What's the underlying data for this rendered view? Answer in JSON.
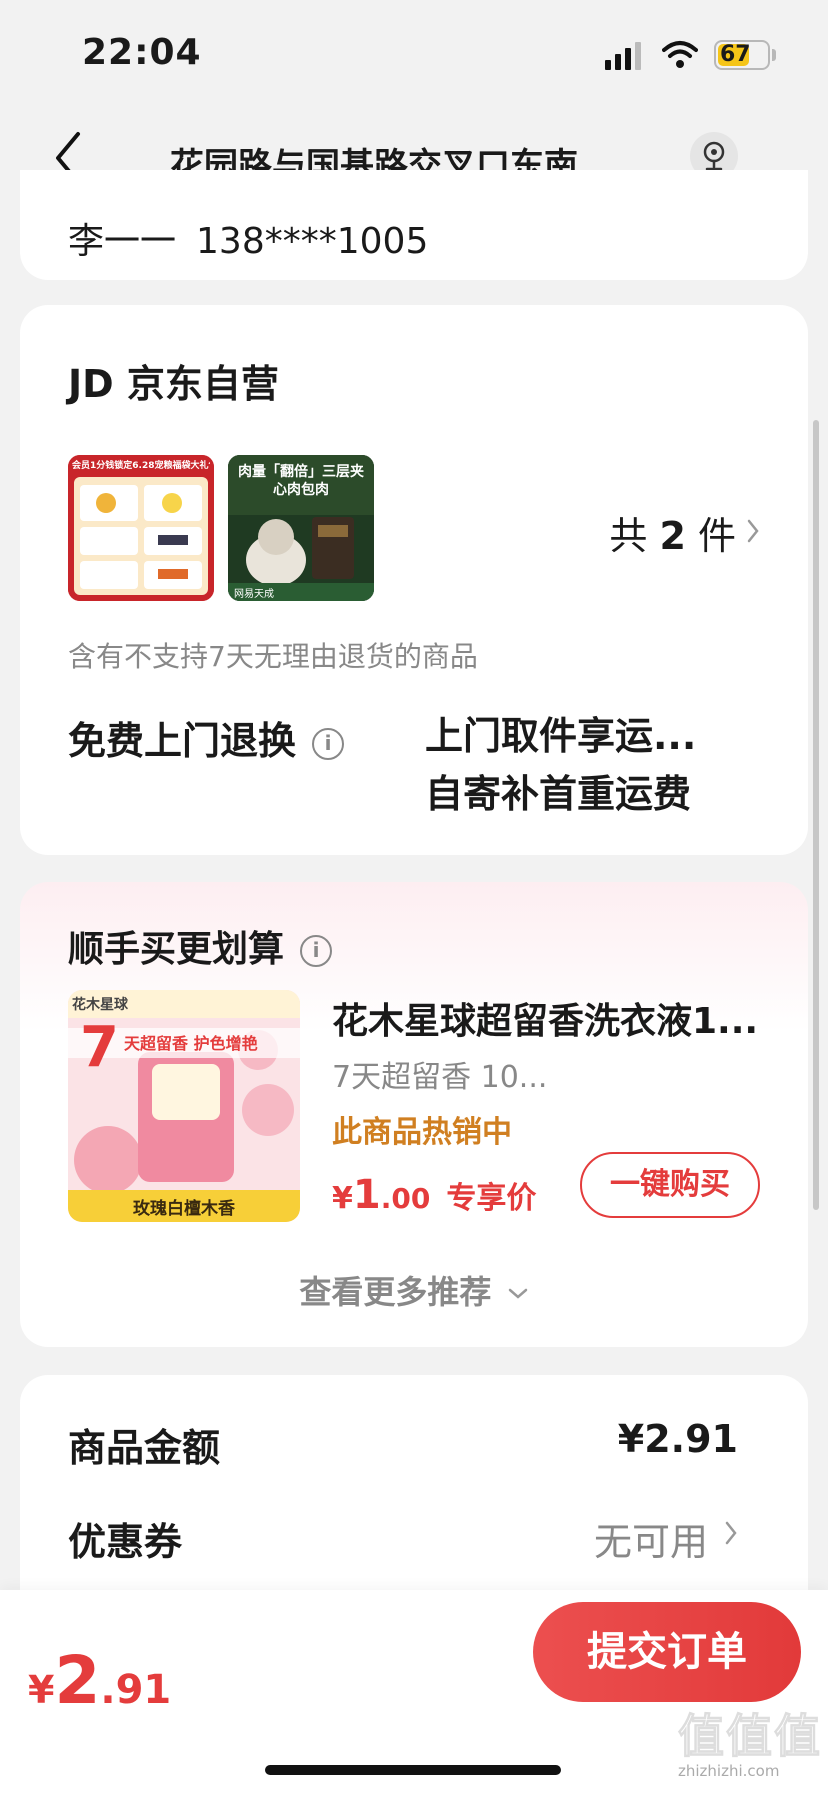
{
  "status_bar": {
    "time": "22:04",
    "battery": "67",
    "battery_level_percent": 67
  },
  "nav": {
    "title": "花园路与国基路交叉口东南..."
  },
  "address": {
    "name": "李一一",
    "phone": "138****1005"
  },
  "order": {
    "shop_name": "JD 京东自营",
    "item_count_prefix": "共",
    "item_count": "2",
    "item_count_suffix": "件",
    "thumb1_text": "会员1分钱锁定6.28宠粮福袋大礼包",
    "thumb2_text": "肉量「翻倍」三层夹心肉包肉",
    "thumb2_brand": "网易天成",
    "return_notice": "含有不支持7天无理由退货的商品",
    "return_label": "免费上门退换",
    "return_line1": "上门取件享运...",
    "return_line2": "自寄补首重运费"
  },
  "recommend": {
    "title": "顺手买更划算",
    "product_name": "花木星球超留香洗衣液1...",
    "product_sub": "7天超留香 10...",
    "hot_text": "此商品热销中",
    "price_currency": "¥",
    "price_int": "1",
    "price_dec": ".00",
    "price_tag": "专享价",
    "buy_label": "一键购买",
    "more_label": "查看更多推荐",
    "img_big": "7",
    "img_banner": "天超留香 护色增艳",
    "img_brand": "花木星球",
    "img_caption": "玫瑰白檀木香"
  },
  "summary": {
    "goods_label": "商品金额",
    "goods_value": "¥2.91",
    "coupon_label": "优惠券",
    "coupon_value": "无可用"
  },
  "bottom": {
    "total_currency": "¥",
    "total_int": "2",
    "total_dec": ".91",
    "submit_label": "提交订单"
  },
  "watermark": {
    "main": "值值值",
    "sub": "zhizhizhi.com"
  },
  "colors": {
    "accent": "#e43c3c",
    "hot": "#d07f21",
    "muted": "#888888"
  }
}
